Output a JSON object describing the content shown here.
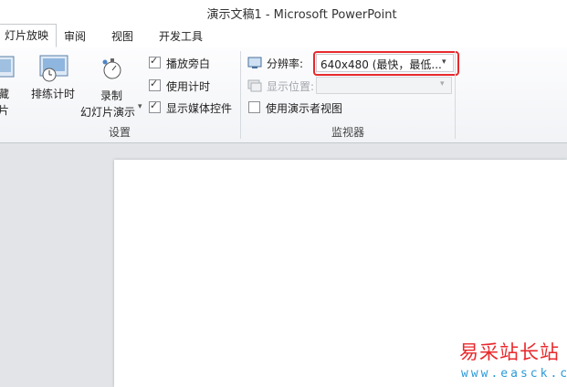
{
  "window": {
    "title": "演示文稿1 - Microsoft PowerPoint"
  },
  "tabs": [
    {
      "label": "灯片放映",
      "active": true
    },
    {
      "label": "审阅",
      "active": false
    },
    {
      "label": "视图",
      "active": false
    },
    {
      "label": "开发工具",
      "active": false
    }
  ],
  "ribbon": {
    "setup_group": {
      "label": "设置",
      "hide_slide": {
        "line1": "隐藏",
        "line2": "灯片"
      },
      "rehearse_timings": "排练计时",
      "record": {
        "line1": "录制",
        "line2": "幻灯片演示"
      },
      "checkboxes": [
        {
          "label": "播放旁白",
          "checked": true
        },
        {
          "label": "使用计时",
          "checked": true
        },
        {
          "label": "显示媒体控件",
          "checked": true
        }
      ]
    },
    "monitors_group": {
      "label": "监视器",
      "resolution_label": "分辨率:",
      "resolution_value": "640x480 (最快，最低...",
      "show_on_label": "显示位置:",
      "show_on_value": "",
      "presenter_view": {
        "label": "使用演示者视图",
        "checked": false
      }
    }
  },
  "watermark": {
    "cn": "易采站长站",
    "url": "www.easck.com"
  },
  "colors": {
    "highlight_box": "#e8292c",
    "watermark_red": "#e8292c",
    "watermark_blue": "#2b9ad8"
  }
}
